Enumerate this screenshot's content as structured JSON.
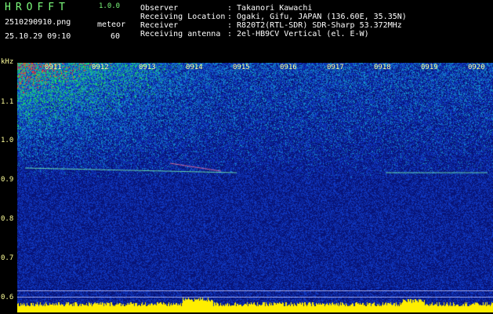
{
  "header": {
    "brand": "HROFFT",
    "version": "1.0.0",
    "filename": "2510290910.png",
    "timestamp": "25.10.29 09:10",
    "meteor_label": "meteor",
    "meteor_count": "60",
    "info": [
      {
        "label": "Observer",
        "value": ": Takanori Kawachi"
      },
      {
        "label": "Receiving Location",
        "value": ": Ogaki, Gifu, JAPAN (136.60E, 35.35N)"
      },
      {
        "label": "Receiver",
        "value": ": R820T2(RTL-SDR) SDR-Sharp 53.372MHz"
      },
      {
        "label": "Receiving antenna",
        "value": ": 2el-HB9CV Vertical (el. E-W)"
      }
    ]
  },
  "axis": {
    "unit": "kHz",
    "y_ticks": [
      "1.1",
      "1.0",
      "0.9",
      "0.8",
      "0.7",
      "0.6"
    ],
    "x_ticks": [
      "0911",
      "0912",
      "0913",
      "0914",
      "0915",
      "0916",
      "0917",
      "0918",
      "0919",
      "0920"
    ]
  },
  "colors": {
    "background": "#000000",
    "noise_base": "#0a1a8c",
    "signal": "#00ff66",
    "hot": "#ff3322",
    "bottom_band": "#ffee00",
    "axis_text": "#ffff99"
  }
}
